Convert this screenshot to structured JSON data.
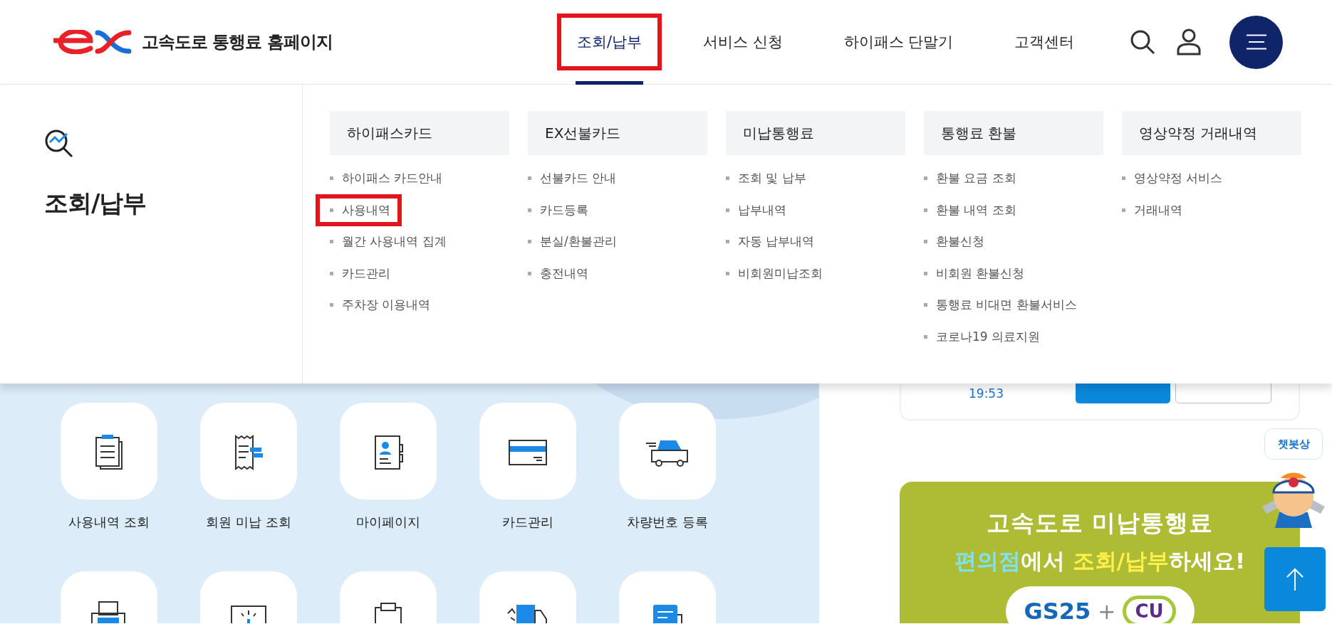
{
  "header": {
    "site_title": "고속도로 통행료 홈페이지",
    "nav": [
      {
        "label": "조회/납부",
        "selected": true,
        "highlighted": true
      },
      {
        "label": "서비스 신청",
        "selected": false,
        "highlighted": false
      },
      {
        "label": "하이패스 단말기",
        "selected": false,
        "highlighted": false
      },
      {
        "label": "고객센터",
        "selected": false,
        "highlighted": false
      }
    ]
  },
  "mega_menu": {
    "title": "조회/납부",
    "columns": [
      {
        "heading": "하이패스카드",
        "items": [
          {
            "label": "하이패스 카드안내",
            "highlighted": false
          },
          {
            "label": "사용내역",
            "highlighted": true
          },
          {
            "label": "월간 사용내역 집계",
            "highlighted": false
          },
          {
            "label": "카드관리",
            "highlighted": false
          },
          {
            "label": "주차장 이용내역",
            "highlighted": false
          }
        ]
      },
      {
        "heading": "EX선불카드",
        "items": [
          {
            "label": "선불카드 안내",
            "highlighted": false
          },
          {
            "label": "카드등록",
            "highlighted": false
          },
          {
            "label": "분실/환불관리",
            "highlighted": false
          },
          {
            "label": "충전내역",
            "highlighted": false
          }
        ]
      },
      {
        "heading": "미납통행료",
        "items": [
          {
            "label": "조회 및 납부",
            "highlighted": false
          },
          {
            "label": "납부내역",
            "highlighted": false
          },
          {
            "label": "자동 납부내역",
            "highlighted": false
          },
          {
            "label": "비회원미납조회",
            "highlighted": false
          }
        ]
      },
      {
        "heading": "통행료 환불",
        "items": [
          {
            "label": "환불 요금 조회",
            "highlighted": false
          },
          {
            "label": "환불 내역 조회",
            "highlighted": false
          },
          {
            "label": "환불신청",
            "highlighted": false
          },
          {
            "label": "비회원 환불신청",
            "highlighted": false
          },
          {
            "label": "통행료 비대면 환불서비스",
            "highlighted": false
          },
          {
            "label": "코로나19 의료지원",
            "highlighted": false
          }
        ]
      },
      {
        "heading": "영상약정 거래내역",
        "items": [
          {
            "label": "영상약정 서비스",
            "highlighted": false
          },
          {
            "label": "거래내역",
            "highlighted": false
          }
        ]
      }
    ]
  },
  "quick_links": {
    "rows": [
      [
        {
          "kind": "labeled",
          "label": "사용내역 조회"
        },
        {
          "kind": "labeled",
          "label": "회원 미납 조회"
        },
        {
          "kind": "labeled",
          "label": "마이페이지"
        },
        {
          "kind": "labeled",
          "label": "카드관리"
        },
        {
          "kind": "labeled",
          "label": "차량번호 등록"
        }
      ],
      [
        {
          "kind": "tile"
        },
        {
          "kind": "tile"
        },
        {
          "kind": "tile"
        },
        {
          "kind": "tile"
        },
        {
          "kind": "tile"
        }
      ]
    ]
  },
  "side": {
    "card_time": "19:53",
    "chatbot_label": "챗봇상",
    "banner": {
      "line_1": "고속도로 미납통행료",
      "line_2": [
        {
          "text": "편의점",
          "color": "#7fe3f7"
        },
        {
          "text": "에서 ",
          "color": "#ffffff"
        },
        {
          "text": "조회/납부",
          "color": "#fff04a"
        },
        {
          "text": "하세요!",
          "color": "#ffffff"
        }
      ],
      "brands": [
        {
          "text": "GS25",
          "kind": "gs"
        },
        {
          "text": "+",
          "kind": "plus"
        },
        {
          "text": "CU",
          "kind": "cu"
        }
      ]
    }
  }
}
